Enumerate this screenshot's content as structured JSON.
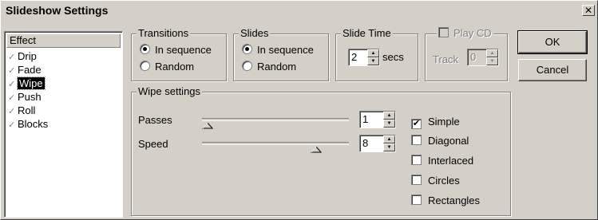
{
  "window": {
    "title": "Slideshow Settings",
    "close_glyph": "✕"
  },
  "effects": {
    "header": "Effect",
    "items": [
      {
        "label": "Drip",
        "checked": true,
        "selected": false
      },
      {
        "label": "Fade",
        "checked": true,
        "selected": false
      },
      {
        "label": "Wipe",
        "checked": true,
        "selected": true
      },
      {
        "label": "Push",
        "checked": true,
        "selected": false
      },
      {
        "label": "Roll",
        "checked": true,
        "selected": false
      },
      {
        "label": "Blocks",
        "checked": true,
        "selected": false
      }
    ],
    "check_glyph": "✓"
  },
  "transitions": {
    "label": "Transitions",
    "options": [
      {
        "label": "In sequence",
        "selected": true
      },
      {
        "label": "Random",
        "selected": false
      }
    ]
  },
  "slides": {
    "label": "Slides",
    "options": [
      {
        "label": "In sequence",
        "selected": true
      },
      {
        "label": "Random",
        "selected": false
      }
    ]
  },
  "slide_time": {
    "label": "Slide Time",
    "value": "2",
    "unit": "secs"
  },
  "play_cd": {
    "label": "Play CD",
    "checked": false,
    "enabled": false,
    "track_label": "Track",
    "track_value": "0"
  },
  "buttons": {
    "ok": "OK",
    "cancel": "Cancel"
  },
  "wipe_settings": {
    "label": "Wipe settings",
    "passes": {
      "label": "Passes",
      "value": "1",
      "slider_level": 0.0
    },
    "speed": {
      "label": "Speed",
      "value": "8",
      "slider_level": 0.8
    },
    "options": [
      {
        "label": "Simple",
        "checked": true
      },
      {
        "label": "Diagonal",
        "checked": false
      },
      {
        "label": "Interlaced",
        "checked": false
      },
      {
        "label": "Circles",
        "checked": false
      },
      {
        "label": "Rectangles",
        "checked": false
      }
    ]
  },
  "colors": {
    "face": "#d4d0c8",
    "shadow": "#808080",
    "highlight": "#ffffff",
    "dark_shadow": "#404040",
    "selection": "#000000"
  }
}
